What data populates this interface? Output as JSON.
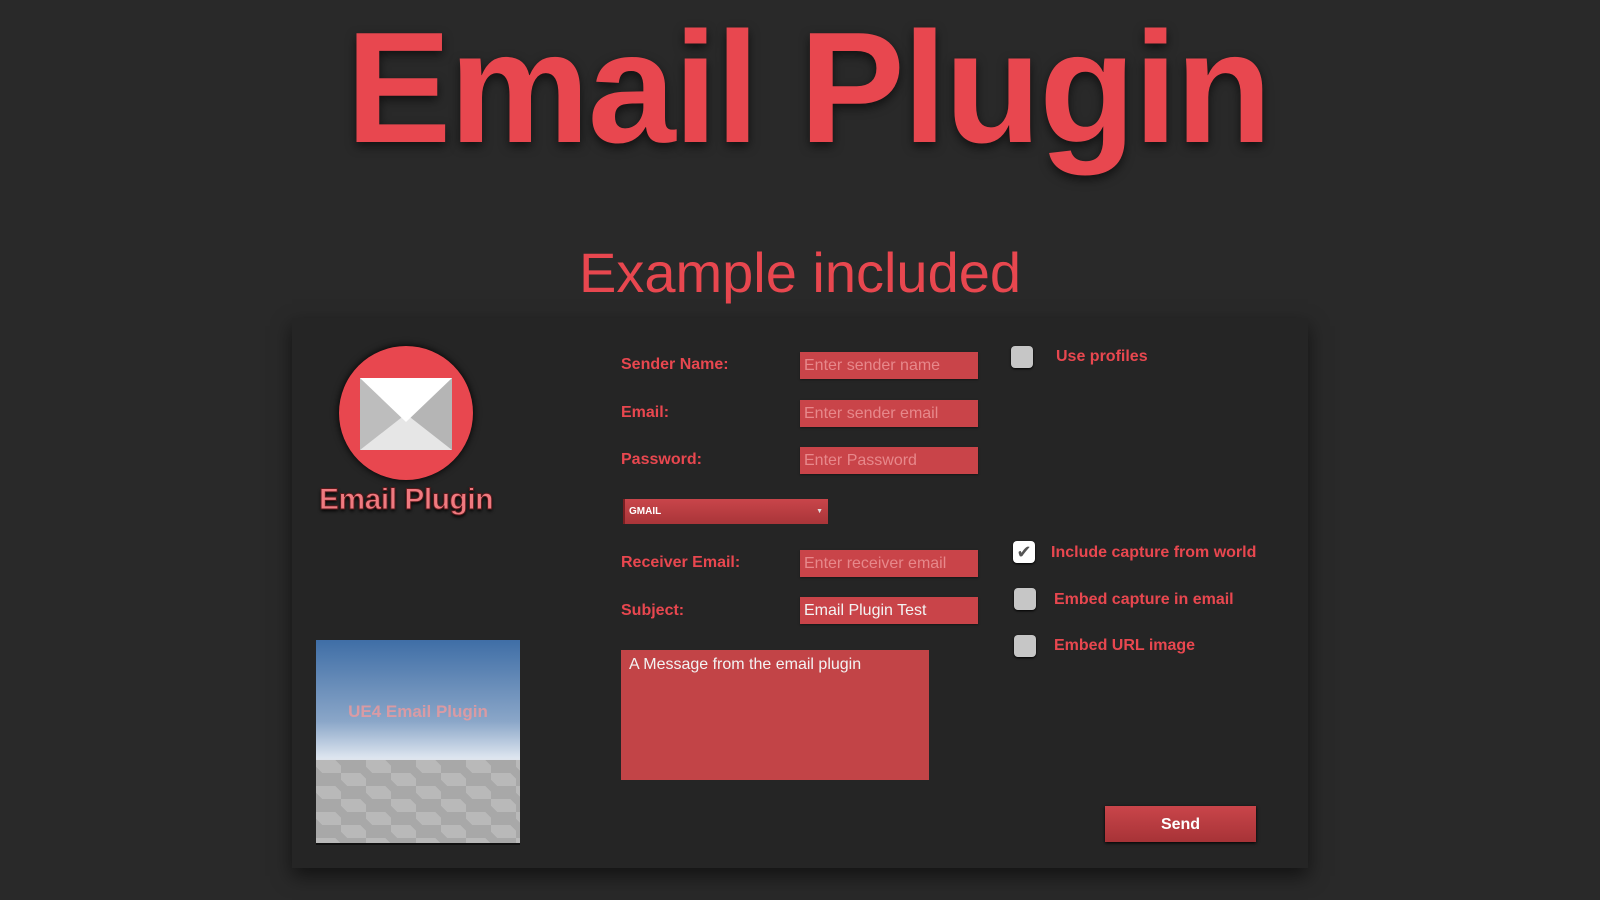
{
  "header": {
    "title": "Email Plugin",
    "subtitle": "Example included"
  },
  "logo": {
    "text": "Email Plugin",
    "icon": "envelope-icon"
  },
  "capture_preview": {
    "text": "UE4 Email Plugin"
  },
  "form": {
    "sender_name": {
      "label": "Sender Name:",
      "placeholder": "Enter sender name",
      "value": ""
    },
    "email": {
      "label": "Email:",
      "placeholder": "Enter sender email",
      "value": ""
    },
    "password": {
      "label": "Password:",
      "placeholder": "Enter Password",
      "value": ""
    },
    "provider": {
      "selected": "GMAIL"
    },
    "receiver_email": {
      "label": "Receiver Email:",
      "placeholder": "Enter receiver email",
      "value": ""
    },
    "subject": {
      "label": "Subject:",
      "value": "Email Plugin Test"
    },
    "message": {
      "value": "A Message from the email plugin"
    }
  },
  "options": [
    {
      "label": "Use profiles",
      "checked": false
    },
    {
      "label": "Include capture from world",
      "checked": true
    },
    {
      "label": "Embed capture in email",
      "checked": false
    },
    {
      "label": "Embed URL image",
      "checked": false
    }
  ],
  "send_label": "Send",
  "colors": {
    "accent": "#e8474f",
    "input": "#c94449",
    "background": "#292929",
    "panel": "#252525"
  }
}
